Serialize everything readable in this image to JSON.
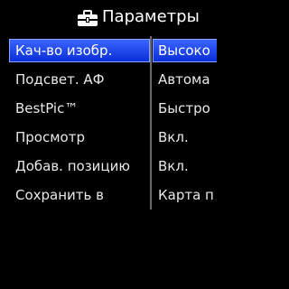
{
  "header": {
    "icon": "toolbox-icon",
    "title": "Параметры"
  },
  "menu": {
    "selected_index": 0,
    "items": [
      {
        "label": "Кач-во изобр.",
        "value": "Высоко"
      },
      {
        "label": "Подсвет. АФ",
        "value": "Автома"
      },
      {
        "label": "BestPic™",
        "value": "Быстро"
      },
      {
        "label": "Просмотр",
        "value": "Вкл."
      },
      {
        "label": "Добав. позицию",
        "value": "Вкл."
      },
      {
        "label": "Сохранить в",
        "value": "Карта п"
      }
    ]
  },
  "colors": {
    "background": "#000000",
    "selection": "#1f4cff",
    "text": "#ffffff"
  }
}
